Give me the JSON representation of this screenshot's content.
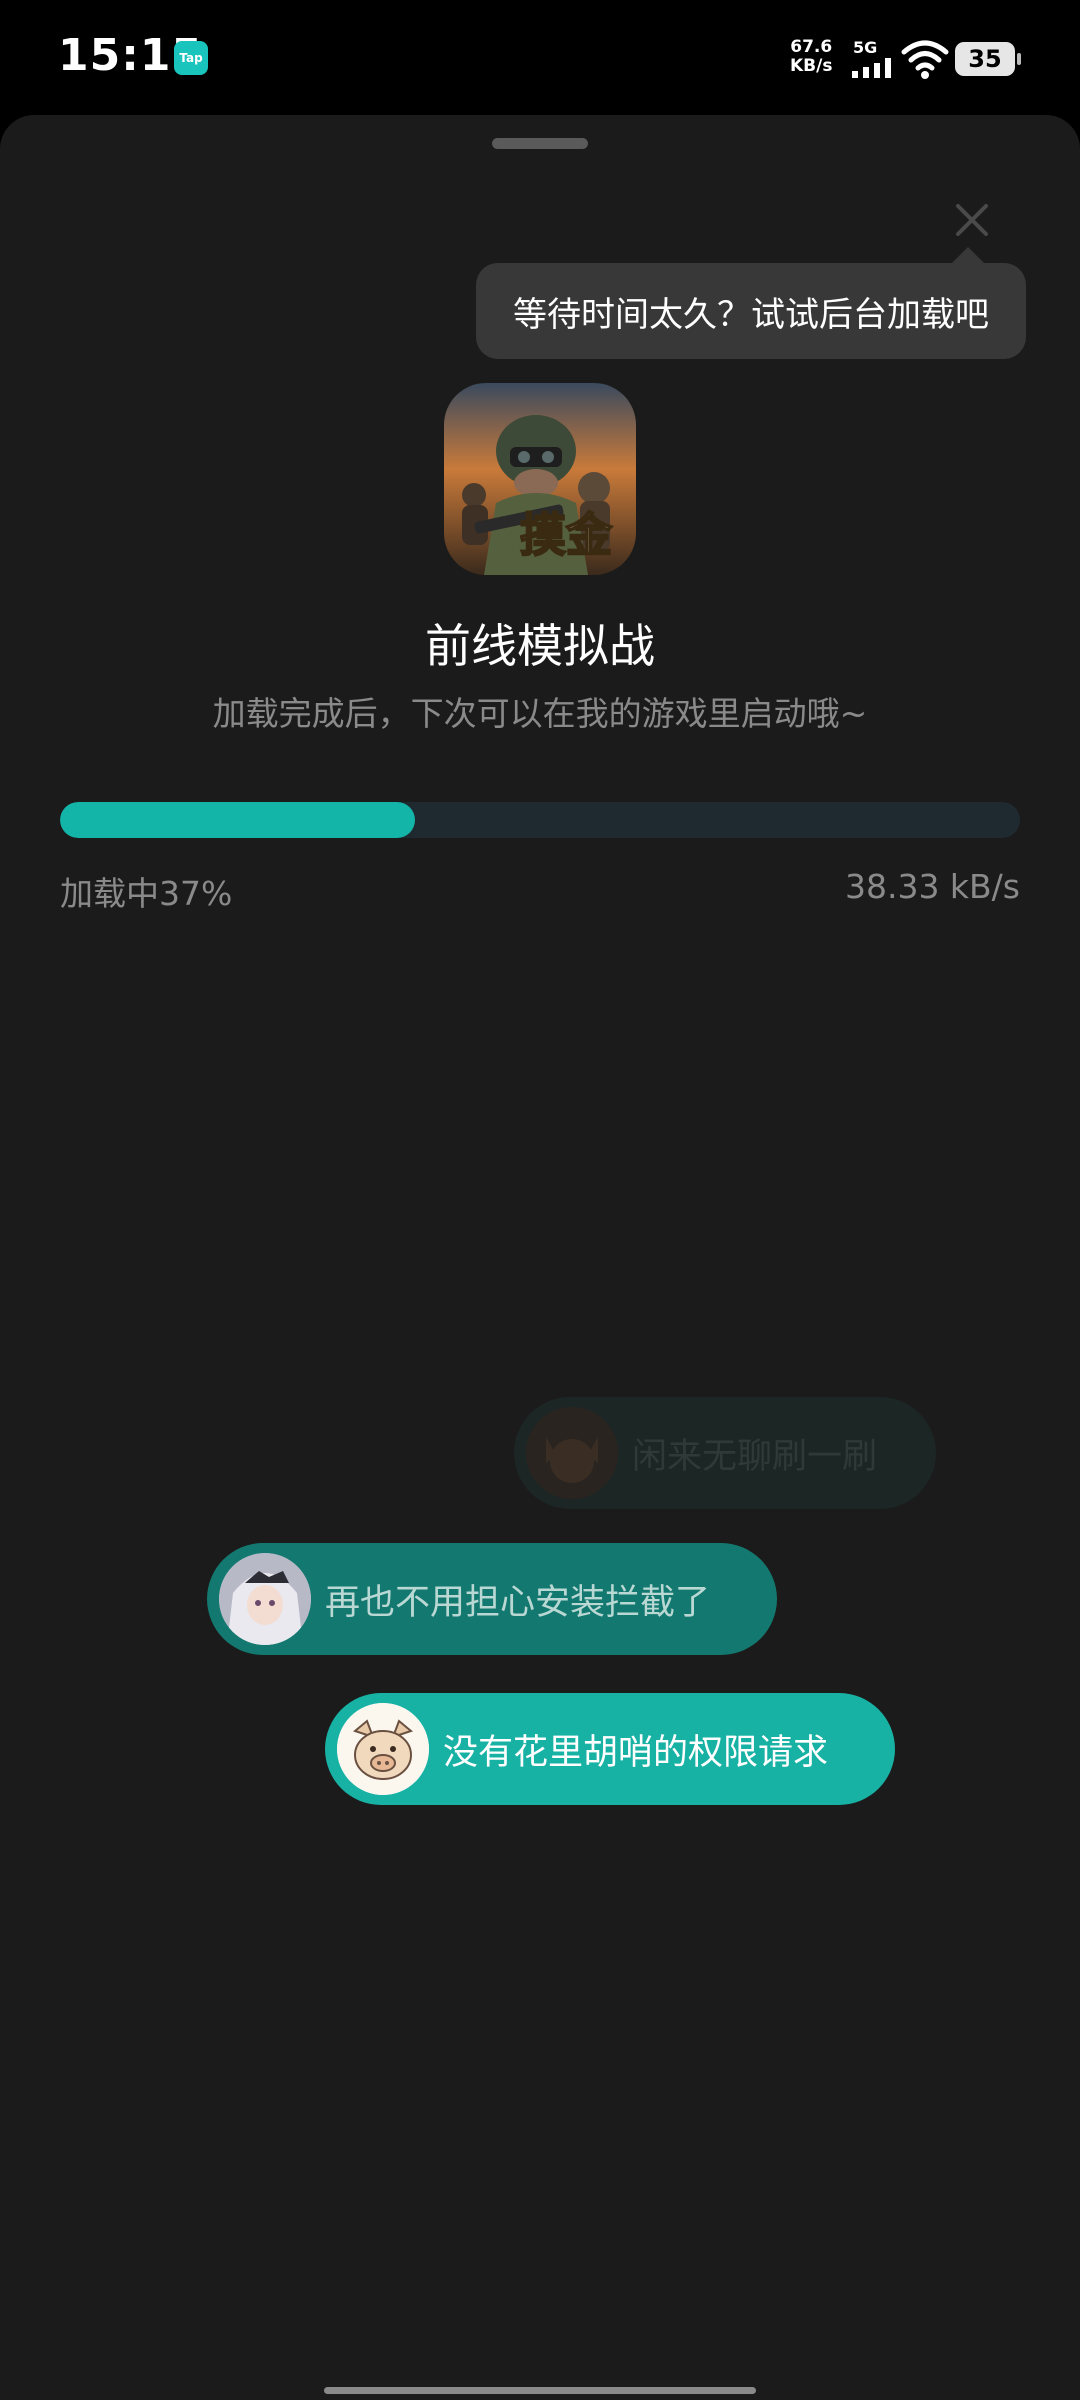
{
  "status_bar": {
    "time": "15:15",
    "app_badge": "Tap",
    "net_speed": "67.6",
    "net_unit": "KB/s",
    "network": "5G",
    "battery": "35"
  },
  "tooltip": {
    "text": "等待时间太久？试试后台加载吧"
  },
  "app": {
    "icon_text": "摸金",
    "name": "前线模拟战",
    "subtitle": "加载完成后，下次可以在我的游戏里启动哦~"
  },
  "progress": {
    "percent": 37,
    "status_text": "加载中37%",
    "speed_text": "38.33 kB/s"
  },
  "bubbles": [
    {
      "text": "闲来无聊刷一刷",
      "avatar": "cat-avatar-icon"
    },
    {
      "text": "再也不用担心安装拦截了",
      "avatar": "anime-girl-avatar-icon"
    },
    {
      "text": "没有花里胡哨的权限请求",
      "avatar": "pig-avatar-icon"
    }
  ],
  "colors": {
    "accent": "#12b5a8",
    "sheet": "#1b1b1b",
    "tooltip": "#383838"
  }
}
